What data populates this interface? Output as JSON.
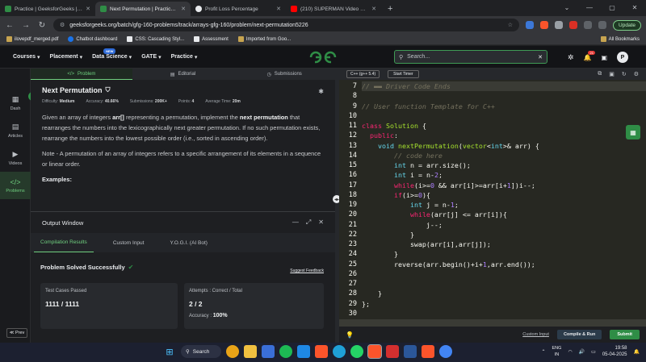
{
  "browser": {
    "tabs": [
      {
        "title": "Practice | GeeksforGeeks | A comp",
        "color": "#2f8d46",
        "active": false
      },
      {
        "title": "Next Permutation | Practice | G",
        "color": "#2f8d46",
        "active": true
      },
      {
        "title": "Profit Loss Percentage",
        "color": "#e8eaed",
        "active": false
      },
      {
        "title": "(210) SUPERMAN Video Song |",
        "color": "#ff0000",
        "active": false
      }
    ],
    "url": "geeksforgeeks.org/batch/gfg-160-problems/track/arrays-gfg-160/problem/next-permutation5226",
    "update_label": "Update",
    "bookmarks": [
      "ilovepdf_merged.pdf",
      "Chatbot dashboard",
      "CSS: Cascading Styl...",
      "Assessment",
      "Imported from Goo..."
    ],
    "all_bookmarks": "All Bookmarks"
  },
  "nav": {
    "items": [
      "Courses",
      "Placement",
      "Data Science",
      "GATE",
      "Practice"
    ],
    "new_badge": "NEW",
    "logo": "GG",
    "search_placeholder": "Search...",
    "notif_count": "21",
    "avatar": "P"
  },
  "rail": {
    "items": [
      {
        "label": "Dash",
        "icon": "▦"
      },
      {
        "label": "Articles",
        "icon": "▤"
      },
      {
        "label": "Videos",
        "icon": "▶"
      },
      {
        "label": "Problems",
        "icon": "</>"
      }
    ],
    "prev": "≪ Prev"
  },
  "problem": {
    "tabs": [
      "Problem",
      "Editorial",
      "Submissions"
    ],
    "title": "Next Permutation",
    "meta": {
      "difficulty_label": "Difficulty:",
      "difficulty": "Medium",
      "accuracy_label": "Accuracy:",
      "accuracy": "40.66%",
      "submissions_label": "Submissions:",
      "submissions": "200K+",
      "points_label": "Points:",
      "points": "4",
      "time_label": "Average Time:",
      "time": "20m"
    },
    "desc_1": "Given an array of integers ",
    "desc_arr": "arr[]",
    "desc_2": " representing a permutation, implement the ",
    "desc_np": "next permutation",
    "desc_3": " that rearranges the numbers into the lexicographically next greater permutation. If no such permutation exists, rearrange the numbers into the lowest possible order (i.e., sorted in ascending order).",
    "note": "Note - A permutation of an array of integers refers to a specific arrangement of its elements in a sequence or linear order.",
    "examples": "Examples:"
  },
  "output": {
    "title": "Output Window",
    "tabs": [
      "Compilation Results",
      "Custom Input",
      "Y.O.G.I. (AI Bot)"
    ],
    "status": "Problem Solved Successfully",
    "suggest": "Suggest Feedback",
    "cases_label": "Test Cases Passed",
    "cases_value": "1111 / 1111",
    "attempts_label": "Attempts : Correct / Total",
    "attempts_value": "2 / 2",
    "accuracy_label": "Accuracy :",
    "accuracy_value": "100%"
  },
  "editor": {
    "language": "C++ (g++ 5.4)",
    "timer": "Start Timer",
    "line_numbers": [
      "7",
      "8",
      "9",
      "10",
      "11",
      "12",
      "13",
      "14",
      "15",
      "16",
      "17",
      "18",
      "19",
      "20",
      "21",
      "22",
      "23",
      "24",
      "25",
      "26",
      "27",
      "28",
      "29",
      "30"
    ],
    "custom_input": "Custom Input",
    "compile_run": "Compile & Run",
    "submit": "Submit"
  },
  "taskbar": {
    "search": "Search",
    "lang_top": "ENG",
    "lang_bottom": "IN",
    "time": "19:58",
    "date": "05-04-2025"
  }
}
